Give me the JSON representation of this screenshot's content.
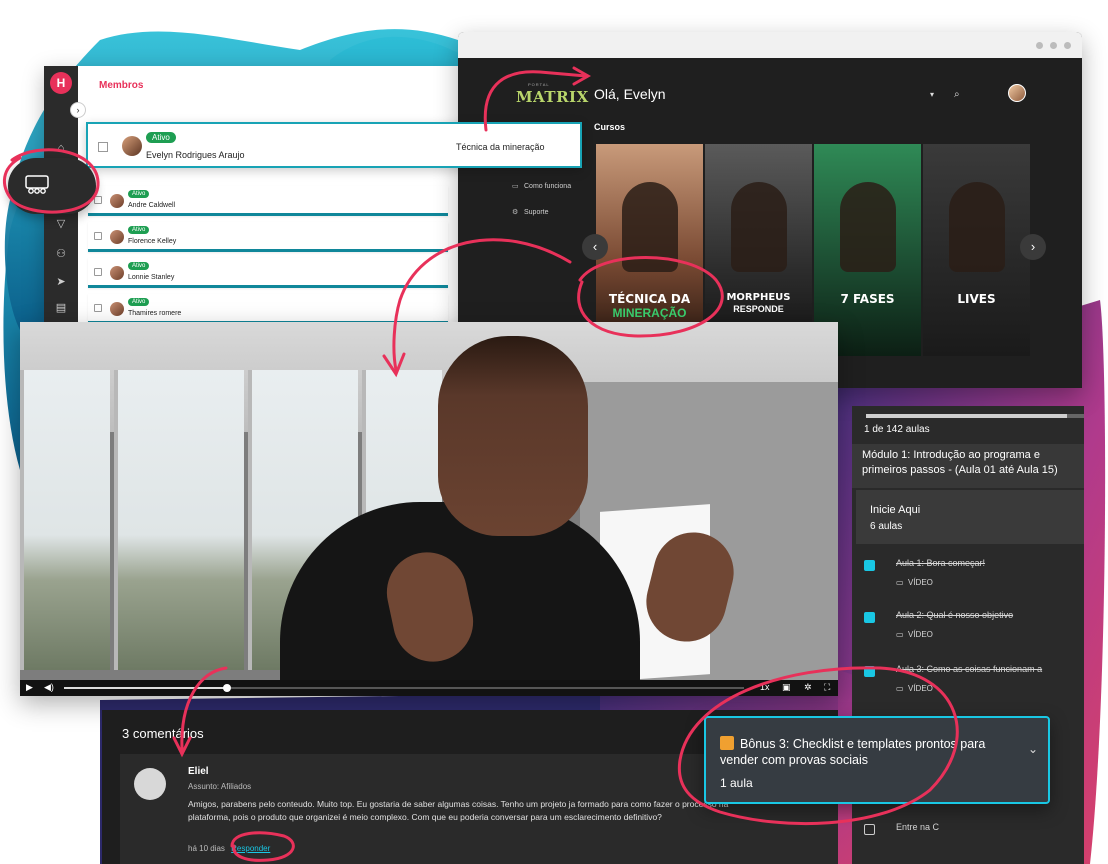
{
  "colors": {
    "accent_pink": "#e8315a",
    "accent_cyan": "#19c7e4",
    "teal": "#10879a",
    "dark_bg": "#1f1f1f",
    "active_green": "#1e9e52"
  },
  "members_panel": {
    "title": "Membros",
    "logo_letter": "H",
    "rail_icons": [
      "home-icon",
      "members-icon",
      "filter-icon",
      "group-icon",
      "send-icon",
      "cards-icon"
    ],
    "highlight_member": {
      "status": "Ativo",
      "name": "Evelyn Rodrigues Araujo",
      "course": "Técnica da mineração"
    },
    "members": [
      {
        "status": "Ativo",
        "name": "Andre Caldwell"
      },
      {
        "status": "Ativo",
        "name": "Florence Kelley"
      },
      {
        "status": "Ativo",
        "name": "Lonnie Stanley"
      },
      {
        "status": "Ativo",
        "name": "Thamires romere"
      }
    ]
  },
  "matrix": {
    "logo_small": "PORTAL",
    "logo": "MATRIX",
    "greeting": "Olá, Evelyn",
    "section_title": "Cursos",
    "menu": [
      {
        "icon": "video-icon",
        "label": "Como funciona"
      },
      {
        "icon": "gear-icon",
        "label": "Suporte"
      }
    ],
    "courses": [
      {
        "title": "TÉCNICA DA",
        "subtitle": "MINERAÇÃO",
        "subtitle_color": "#3bd16f",
        "bg": "#7a4a33"
      },
      {
        "title": "MORPHEUS",
        "subtitle": "RESPONDE",
        "subtitle_color": "#ffffff",
        "bg": "#3b3b3b"
      },
      {
        "title": "7 FASES",
        "subtitle": "",
        "subtitle_color": "#ffffff",
        "bg": "#1f5a36"
      },
      {
        "title": "LIVES",
        "subtitle": "",
        "subtitle_color": "#ffffff",
        "bg": "#2a2a2a"
      }
    ],
    "prev_label": "‹",
    "next_label": "›"
  },
  "video": {
    "speed": "1x",
    "progress": 0.24
  },
  "lessons": {
    "progress": 0.92,
    "count": "1 de 142 aulas",
    "module": "Módulo 1: Introdução ao programa e primeiros passos - (Aula 01 até Aula 15)",
    "section_title": "Inicie Aqui",
    "section_count": "6 aulas",
    "items": [
      {
        "title": "Aula 1: Bora começar!",
        "type": "VÍDEO",
        "done": true
      },
      {
        "title": "Aula 2: Qual é nosso objetivo",
        "type": "VÍDEO",
        "done": true
      },
      {
        "title": "Aula 3: Como as coisas funcionam a",
        "type": "VÍDEO",
        "done": true
      }
    ],
    "last_item": "Entre na C"
  },
  "comments": {
    "heading": "3 comentários",
    "author": "Eliel",
    "subject": "Assunto: Afiliados",
    "body": "Amigos, parabens pelo conteudo. Muito top. Eu gostaria de saber algumas coisas. Tenho um projeto ja formado para como fazer o processo na plataforma, pois o produto que organizei é meio complexo. Com que eu poderia conversar para um esclarecimento definitivo?",
    "time": "há 10 dias",
    "reply": "Responder"
  },
  "bonus": {
    "icon": "gift-icon",
    "title": "Bônus 3: Checklist e templates prontos para vender com provas sociais",
    "count": "1 aula"
  }
}
